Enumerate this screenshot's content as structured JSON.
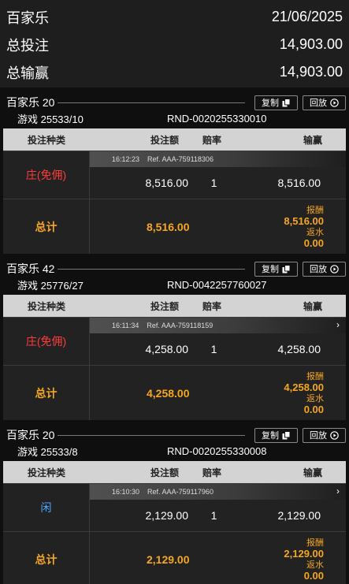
{
  "summary": {
    "title": "百家乐",
    "date": "21/06/2025",
    "total_bet_label": "总投注",
    "total_bet": "14,903.00",
    "total_winlose_label": "总输赢",
    "total_winlose": "14,903.00"
  },
  "labels": {
    "copy": "复制",
    "replay": "回放",
    "col_bet_type": "投注种类",
    "col_bet_amount": "投注额",
    "col_odds": "赔率",
    "col_winlose": "输赢",
    "total": "总计",
    "payout": "报酬",
    "rebate": "返水"
  },
  "games": [
    {
      "name": "百家乐 20",
      "game_id": "游戏 25533/10",
      "round": "RND-0020255330010",
      "bet_type": "庄(免佣)",
      "bet_color": "#ff3b3b",
      "time": "16:12:23",
      "ref": "Ref. AAA-759118306",
      "amount": "8,516.00",
      "odds": "1",
      "winlose": "8,516.00",
      "total_amount": "8,516.00",
      "payout": "8,516.00",
      "rebate": "0.00",
      "has_chevron": false
    },
    {
      "name": "百家乐 42",
      "game_id": "游戏 25776/27",
      "round": "RND-0042257760027",
      "bet_type": "庄(免佣)",
      "bet_color": "#ff3b3b",
      "time": "16:11:34",
      "ref": "Ref. AAA-759118159",
      "amount": "4,258.00",
      "odds": "1",
      "winlose": "4,258.00",
      "total_amount": "4,258.00",
      "payout": "4,258.00",
      "rebate": "0.00",
      "has_chevron": true
    },
    {
      "name": "百家乐 20",
      "game_id": "游戏 25533/8",
      "round": "RND-0020255330008",
      "bet_type": "闲",
      "bet_color": "#4da6ff",
      "time": "16:10:30",
      "ref": "Ref. AAA-759117960",
      "amount": "2,129.00",
      "odds": "1",
      "winlose": "2,129.00",
      "total_amount": "2,129.00",
      "payout": "2,129.00",
      "rebate": "0.00",
      "has_chevron": true
    }
  ],
  "icons": {
    "copy": "copy-icon",
    "replay": "play-circle-icon",
    "expand": "chevron-right-icon"
  },
  "colors": {
    "accent": "#f5a623",
    "banker": "#ff3b3b",
    "player": "#4da6ff"
  }
}
